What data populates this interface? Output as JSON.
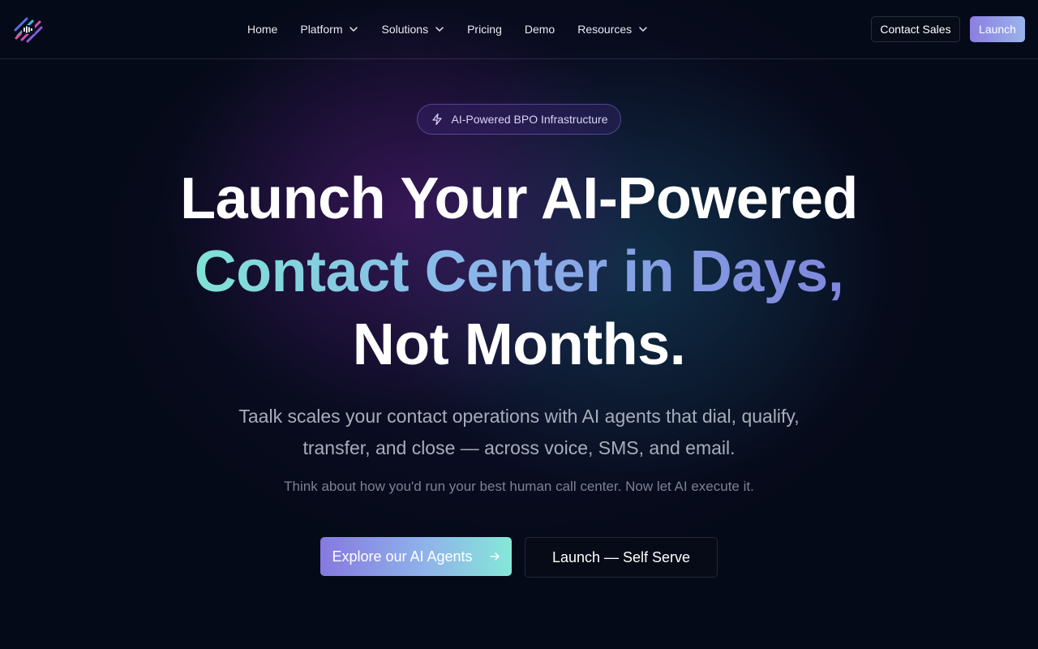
{
  "header": {
    "nav": [
      {
        "label": "Home",
        "dropdown": false
      },
      {
        "label": "Platform",
        "dropdown": true
      },
      {
        "label": "Solutions",
        "dropdown": true
      },
      {
        "label": "Pricing",
        "dropdown": false
      },
      {
        "label": "Demo",
        "dropdown": false
      },
      {
        "label": "Resources",
        "dropdown": true
      }
    ],
    "contact_label": "Contact Sales",
    "launch_label": "Launch"
  },
  "hero": {
    "badge": "AI-Powered BPO Infrastructure",
    "headline_line1": "Launch Your AI-Powered",
    "headline_line2": "Contact Center in Days,",
    "headline_line3": "Not Months.",
    "subtitle_line1": "Taalk scales your contact operations with AI agents that dial, qualify,",
    "subtitle_line2": "transfer, and close — across voice, SMS, and email.",
    "tagline": "Think about how you'd run your best human call center. Now let AI execute it.",
    "primary_cta": "Explore our AI Agents",
    "secondary_cta": "Launch — Self Serve"
  },
  "colors": {
    "background": "#050a18",
    "accent_purple": "#8679e0",
    "accent_teal": "#85e8d8"
  },
  "icons": {
    "logo": "waveform-logo-icon",
    "badge": "lightning-icon",
    "dropdown": "chevron-down-icon",
    "cta": "arrow-right-icon"
  }
}
